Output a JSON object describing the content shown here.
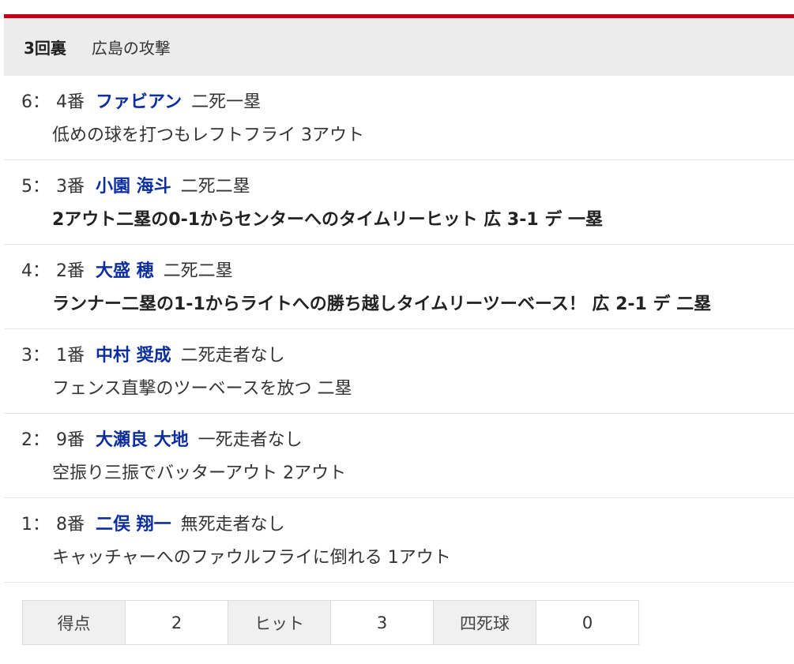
{
  "header": {
    "inning": "3回裏",
    "team_attack": "広島の攻撃",
    "accent_color": "#c3001a"
  },
  "plays": [
    {
      "num": "6：",
      "order": "4番",
      "batter": "ファビアン",
      "situation": "二死一塁",
      "result": "低めの球を打つもレフトフライ 3アウト",
      "highlight": false
    },
    {
      "num": "5：",
      "order": "3番",
      "batter": "小園 海斗",
      "situation": "二死二塁",
      "result": "2アウト二塁の0-1からセンターへのタイムリーヒット 広 3-1 デ 一塁",
      "highlight": true
    },
    {
      "num": "4：",
      "order": "2番",
      "batter": "大盛 穂",
      "situation": "二死二塁",
      "result": "ランナー二塁の1-1からライトへの勝ち越しタイムリーツーベース！ 広 2-1 デ 二塁",
      "highlight": true
    },
    {
      "num": "3：",
      "order": "1番",
      "batter": "中村 奨成",
      "situation": "二死走者なし",
      "result": "フェンス直撃のツーベースを放つ 二塁",
      "highlight": false
    },
    {
      "num": "2：",
      "order": "9番",
      "batter": "大瀬良 大地",
      "situation": "一死走者なし",
      "result": "空振り三振でバッターアウト 2アウト",
      "highlight": false
    },
    {
      "num": "1：",
      "order": "8番",
      "batter": "二俣 翔一",
      "situation": "無死走者なし",
      "result": "キャッチャーへのファウルフライに倒れる 1アウト",
      "highlight": false
    }
  ],
  "summary": {
    "runs_label": "得点",
    "runs_value": "2",
    "hits_label": "ヒット",
    "hits_value": "3",
    "walks_label": "四死球",
    "walks_value": "0"
  }
}
